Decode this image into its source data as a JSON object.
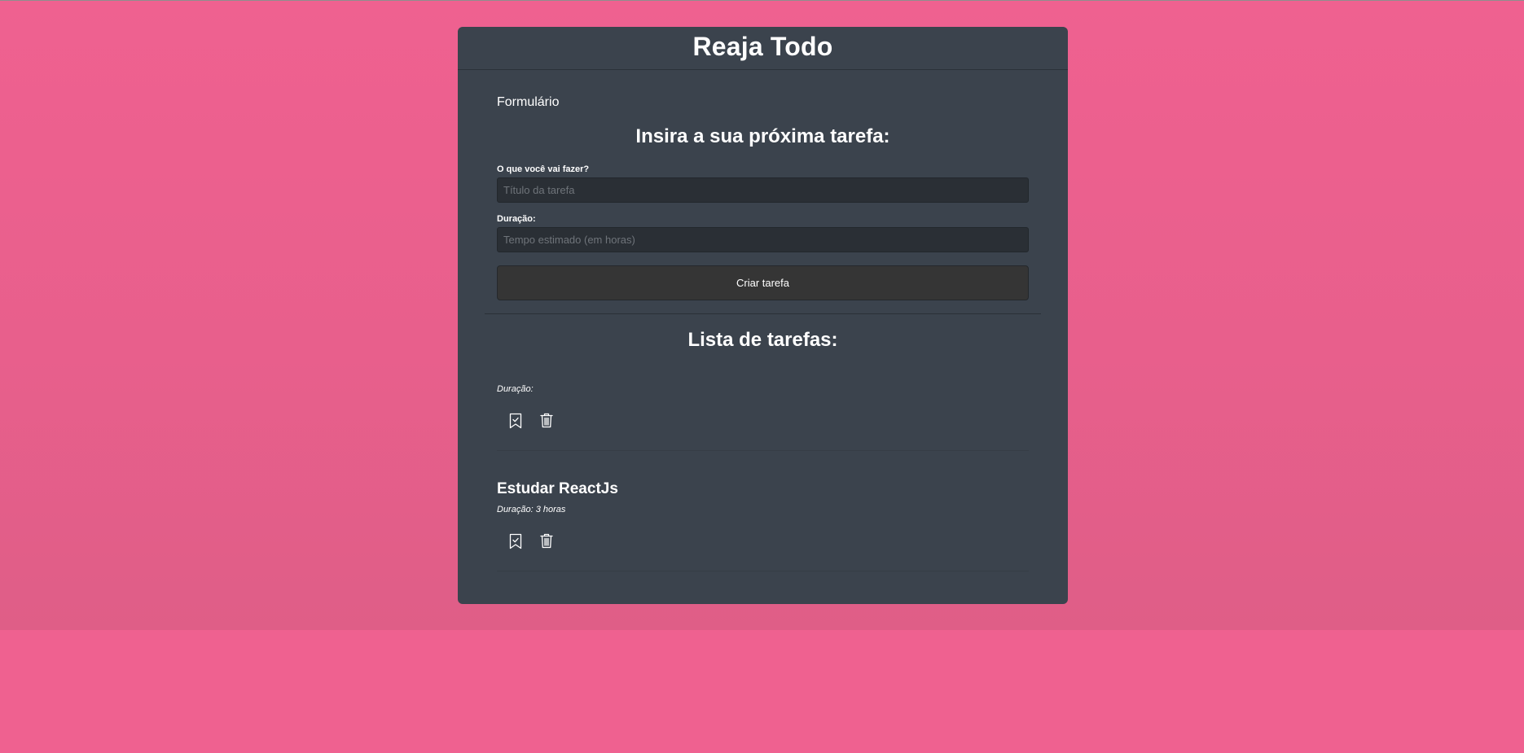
{
  "app": {
    "title": "Reaja Todo"
  },
  "form": {
    "section_label": "Formulário",
    "heading": "Insira a sua próxima tarefa:",
    "title_label": "O que você vai fazer?",
    "title_placeholder": "Título da tarefa",
    "title_value": "",
    "duration_label": "Duração:",
    "duration_placeholder": "Tempo estimado (em horas)",
    "duration_value": "",
    "submit_label": "Criar tarefa"
  },
  "list": {
    "heading": "Lista de tarefas:",
    "tasks": [
      {
        "title": "",
        "duration": "Duração:"
      },
      {
        "title": "Estudar ReactJs",
        "duration": "Duração: 3 horas"
      }
    ],
    "icons": [
      "bookmark-check-icon",
      "trash-icon"
    ]
  },
  "colors": {
    "background": "#ef6190",
    "card": "#3b434d",
    "input": "#2a2f35",
    "button": "#353535",
    "text": "#ffffff"
  }
}
